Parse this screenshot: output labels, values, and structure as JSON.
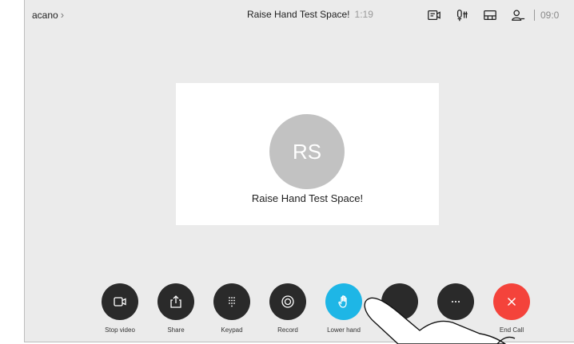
{
  "header": {
    "breadcrumb": "acano",
    "title": "Raise Hand Test Space!",
    "timer": "1:19",
    "clock": "09:0"
  },
  "participant": {
    "initials": "RS",
    "name": "Raise Hand Test Space!"
  },
  "controls": [
    {
      "id": "stop-video",
      "label": "Stop video",
      "icon": "video-camera-icon"
    },
    {
      "id": "share",
      "label": "Share",
      "icon": "share-icon"
    },
    {
      "id": "keypad",
      "label": "Keypad",
      "icon": "keypad-icon"
    },
    {
      "id": "record",
      "label": "Record",
      "icon": "record-icon"
    },
    {
      "id": "lower-hand",
      "label": "Lower hand",
      "icon": "hand-icon",
      "active": true
    },
    {
      "id": "hidden",
      "label": "",
      "icon": "unknown-icon"
    },
    {
      "id": "more",
      "label": "",
      "icon": "more-icon"
    },
    {
      "id": "end-call",
      "label": "End Call",
      "icon": "close-icon"
    }
  ],
  "colors": {
    "background": "#ebebeb",
    "button": "#2a2a2a",
    "active": "#1eb6e6",
    "end_call": "#f4433b",
    "avatar": "#c2c2c2"
  }
}
